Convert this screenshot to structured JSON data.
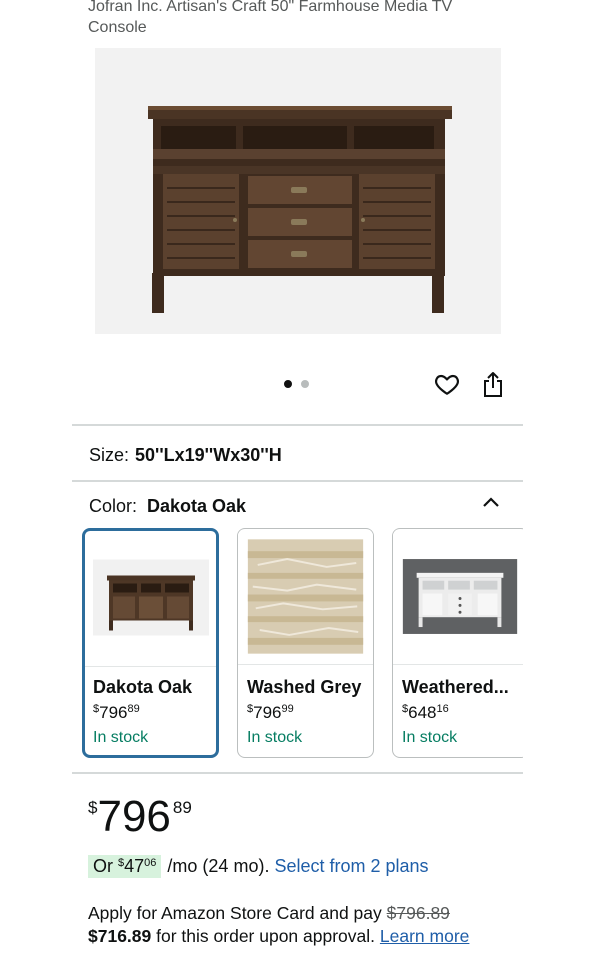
{
  "product": {
    "title": "Jofran Inc. Artisan's Craft 50\" Farmhouse Media TV Console"
  },
  "gallery": {
    "image_icon": "tv-console-photo",
    "dots": 2,
    "active_dot": 1
  },
  "actions": {
    "heart_icon": "heart-icon",
    "share_icon": "share-icon"
  },
  "size": {
    "label": "Size:",
    "value": "50''Lx19''Wx30''H"
  },
  "color": {
    "label": "Color:",
    "value": "Dakota Oak",
    "collapse_icon": "chevron-up-icon",
    "options": [
      {
        "name": "Dakota Oak",
        "currency": "$",
        "whole": "796",
        "fraction": "89",
        "stock": "In stock",
        "selected": true
      },
      {
        "name": "Washed Grey",
        "currency": "$",
        "whole": "796",
        "fraction": "99",
        "stock": "In stock",
        "selected": false
      },
      {
        "name": "Weathered...",
        "currency": "$",
        "whole": "648",
        "fraction": "16",
        "stock": "In stock",
        "selected": false
      }
    ]
  },
  "price": {
    "currency": "$",
    "whole": "796",
    "fraction": "89"
  },
  "financing": {
    "prefix": "Or",
    "currency": "$",
    "whole": "47",
    "fraction": "06",
    "terms": "/mo (24 mo).",
    "link": "Select from 2 plans"
  },
  "store_card": {
    "text_before": "Apply for Amazon Store Card and pay",
    "original_price": "$796.89",
    "discounted_price": "$716.89",
    "text_after": "for this order upon approval.",
    "link": "Learn more"
  },
  "colors": {
    "link": "#1f5ea8",
    "in_stock": "#067d62",
    "selected_border": "#2d6d9c",
    "financing_bg": "#d7f2dd"
  }
}
